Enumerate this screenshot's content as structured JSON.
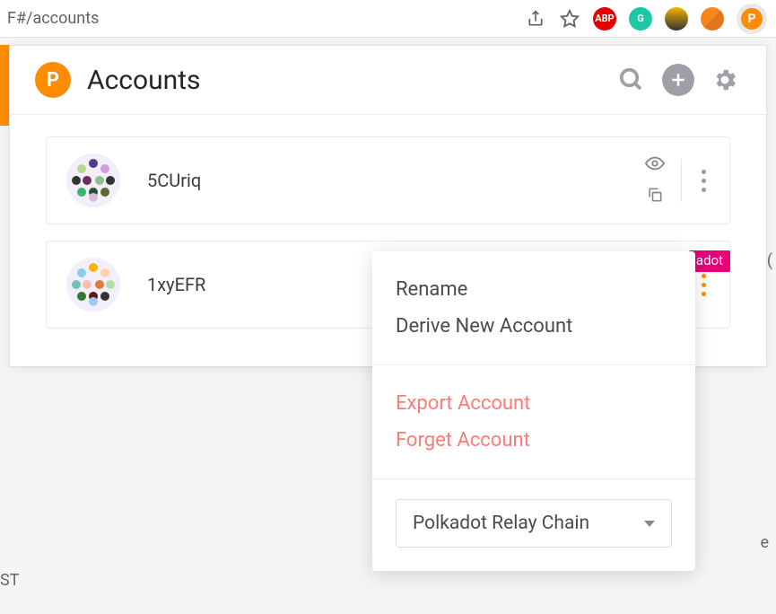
{
  "browser": {
    "url_fragment": "F#/accounts"
  },
  "popup": {
    "title": "Accounts"
  },
  "accounts": [
    {
      "name": "5CUriq"
    },
    {
      "name": "1xyEFR",
      "badge": "adot"
    }
  ],
  "context_menu": {
    "rename": "Rename",
    "derive": "Derive New Account",
    "export": "Export Account",
    "forget": "Forget Account",
    "chain_selected": "Polkadot Relay Chain"
  },
  "background": {
    "right_fragment_top": ".(",
    "right_fragment_mid": "e",
    "left_fragment": "ST"
  }
}
